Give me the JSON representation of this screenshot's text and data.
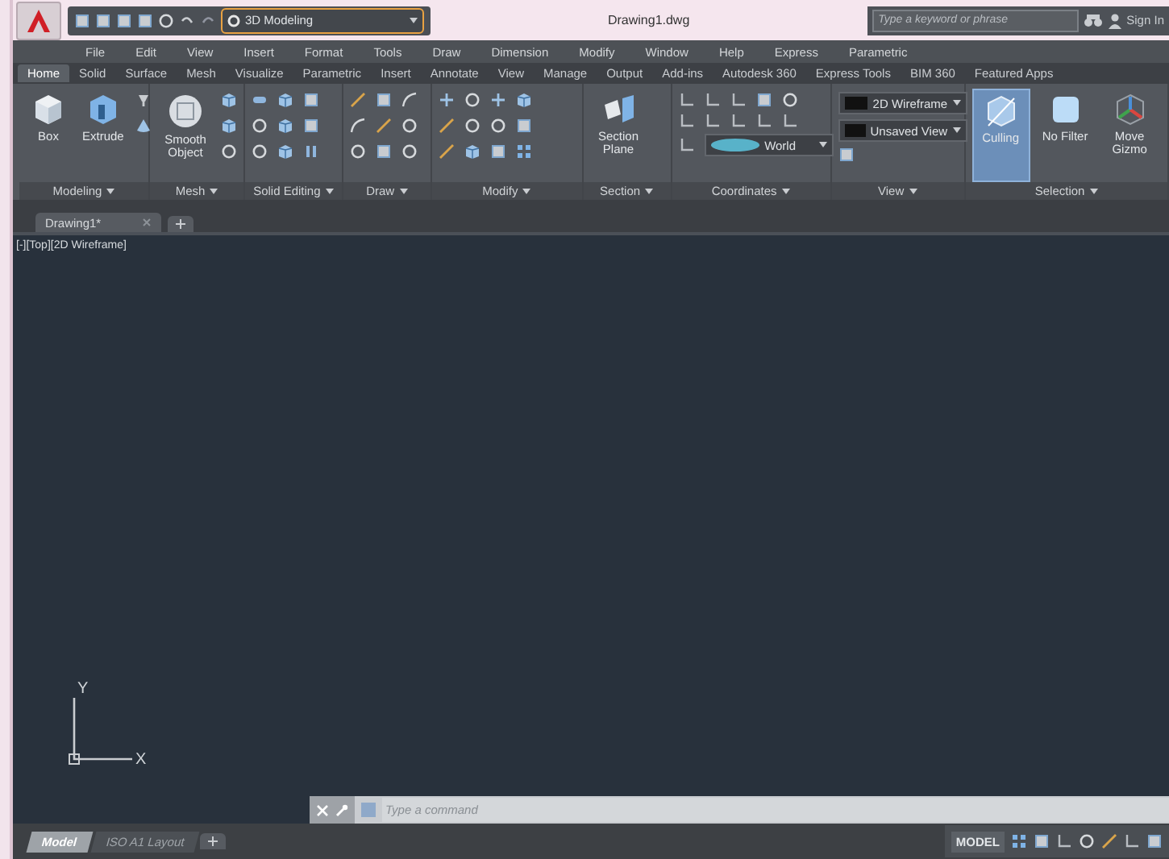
{
  "title_bar": {
    "workspace": "3D Modeling",
    "document_title": "Drawing1.dwg",
    "search": {
      "placeholder": "Type a keyword or phrase"
    },
    "sign_in": "Sign In"
  },
  "menu_bar": [
    "File",
    "Edit",
    "View",
    "Insert",
    "Format",
    "Tools",
    "Draw",
    "Dimension",
    "Modify",
    "Window",
    "Help",
    "Express",
    "Parametric"
  ],
  "ribbon_tabs": [
    {
      "label": "Home",
      "selected": true
    },
    {
      "label": "Solid",
      "selected": false
    },
    {
      "label": "Surface",
      "selected": false
    },
    {
      "label": "Mesh",
      "selected": false
    },
    {
      "label": "Visualize",
      "selected": false
    },
    {
      "label": "Parametric",
      "selected": false
    },
    {
      "label": "Insert",
      "selected": false
    },
    {
      "label": "Annotate",
      "selected": false
    },
    {
      "label": "View",
      "selected": false
    },
    {
      "label": "Manage",
      "selected": false
    },
    {
      "label": "Output",
      "selected": false
    },
    {
      "label": "Add-ins",
      "selected": false
    },
    {
      "label": "Autodesk 360",
      "selected": false
    },
    {
      "label": "Express Tools",
      "selected": false
    },
    {
      "label": "BIM 360",
      "selected": false
    },
    {
      "label": "Featured Apps",
      "selected": false
    }
  ],
  "ribbon_panels": [
    {
      "kind": "modeling",
      "title": "Modeling",
      "buttons": [
        {
          "label": "Box",
          "selected": false
        },
        {
          "label": "Extrude",
          "selected": false
        }
      ]
    },
    {
      "kind": "mesh",
      "title": "Mesh",
      "buttons": [
        {
          "label": "Smooth Object",
          "selected": false
        }
      ]
    },
    {
      "kind": "solid-editing",
      "title": "Solid Editing"
    },
    {
      "kind": "draw",
      "title": "Draw"
    },
    {
      "kind": "modify",
      "title": "Modify"
    },
    {
      "kind": "section",
      "title": "Section",
      "buttons": [
        {
          "label": "Section Plane",
          "selected": false
        }
      ]
    },
    {
      "kind": "coordinates",
      "title": "Coordinates",
      "dropdowns": [
        "World"
      ]
    },
    {
      "kind": "view",
      "title": "View",
      "dropdowns": [
        "2D Wireframe",
        "Unsaved View"
      ]
    },
    {
      "kind": "selection",
      "title": "Selection",
      "buttons": [
        {
          "label": "Culling",
          "selected": true
        },
        {
          "label": "No Filter",
          "selected": false
        },
        {
          "label": "Move Gizmo",
          "selected": false
        }
      ]
    }
  ],
  "file_tabs": [
    {
      "label": "Drawing1*",
      "selected": true
    }
  ],
  "viewport": {
    "label": "[-][Top][2D Wireframe]",
    "axis_y": "Y",
    "axis_x": "X"
  },
  "command_line": {
    "placeholder": "Type a command"
  },
  "layout_tabs": [
    {
      "label": "Model",
      "selected": true
    },
    {
      "label": "ISO A1 Layout",
      "selected": false
    }
  ],
  "status_bar": {
    "mode": "MODEL"
  }
}
